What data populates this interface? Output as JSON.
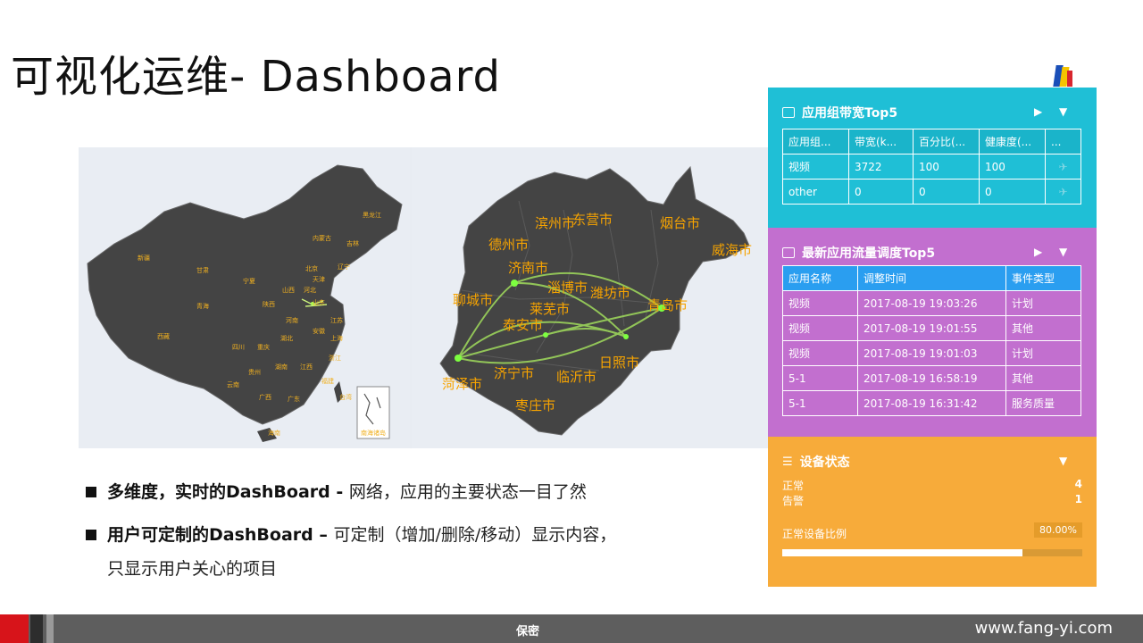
{
  "title": "可视化运维- Dashboard",
  "china_map": {
    "provinces": [
      "黑龙江",
      "吉林",
      "辽宁",
      "内蒙古",
      "北京",
      "天津",
      "河北",
      "山西",
      "山东",
      "新疆",
      "甘肃",
      "宁夏",
      "青海",
      "陕西",
      "河南",
      "江苏",
      "西藏",
      "四川",
      "重庆",
      "湖北",
      "安徽",
      "上海",
      "浙江",
      "云南",
      "贵州",
      "湖南",
      "江西",
      "福建",
      "广西",
      "广东",
      "海南",
      "台湾"
    ],
    "inset_label": "南海诸岛"
  },
  "shandong_map": {
    "cities": [
      "滨州市",
      "东营市",
      "烟台市",
      "德州市",
      "威海市",
      "济南市",
      "淄博市",
      "潍坊市",
      "聊城市",
      "莱芜市",
      "青岛市",
      "泰安市",
      "济宁市",
      "临沂市",
      "日照市",
      "菏泽市",
      "枣庄市"
    ]
  },
  "bullets": [
    {
      "strong": "多维度，实时的DashBoard - ",
      "text": "网络，应用的主要状态一目了然",
      "cont": ""
    },
    {
      "strong": "用户可定制的DashBoard – ",
      "text": "可定制（增加/删除/移动）显示内容，",
      "cont": "只显示用户关心的项目"
    }
  ],
  "panel1": {
    "title": "应用组带宽Top5",
    "headers": [
      "应用组...",
      "带宽(k...",
      "百分比(...",
      "健康度(...",
      "..."
    ],
    "rows": [
      [
        "视频",
        "3722",
        "100",
        "100"
      ],
      [
        "other",
        "0",
        "0",
        "0"
      ]
    ]
  },
  "panel2": {
    "title": "最新应用流量调度Top5",
    "headers": [
      "应用名称",
      "调整时间",
      "事件类型"
    ],
    "rows": [
      [
        "视频",
        "2017-08-19 19:03:26",
        "计划"
      ],
      [
        "视频",
        "2017-08-19 19:01:55",
        "其他"
      ],
      [
        "视频",
        "2017-08-19 19:01:03",
        "计划"
      ],
      [
        "5-1",
        "2017-08-19 16:58:19",
        "其他"
      ],
      [
        "5-1",
        "2017-08-19 16:31:42",
        "服务质量"
      ]
    ]
  },
  "panel3": {
    "title": "设备状态",
    "normal_label": "正常",
    "normal_value": "4",
    "alarm_label": "告警",
    "alarm_value": "1",
    "ratio_label": "正常设备比例",
    "ratio_text": "80.00%",
    "ratio_value": 0.8
  },
  "footer": {
    "confidential": "保密",
    "website": "www.fang-yi.com"
  },
  "colors": {
    "panel1": "#1fbfd6",
    "panel2": "#c26fcf",
    "panel3": "#f7ab3a",
    "map_land": "#444444",
    "map_label": "#f6a300",
    "footer": "#5e5e5e",
    "accent_red": "#d7141a"
  }
}
